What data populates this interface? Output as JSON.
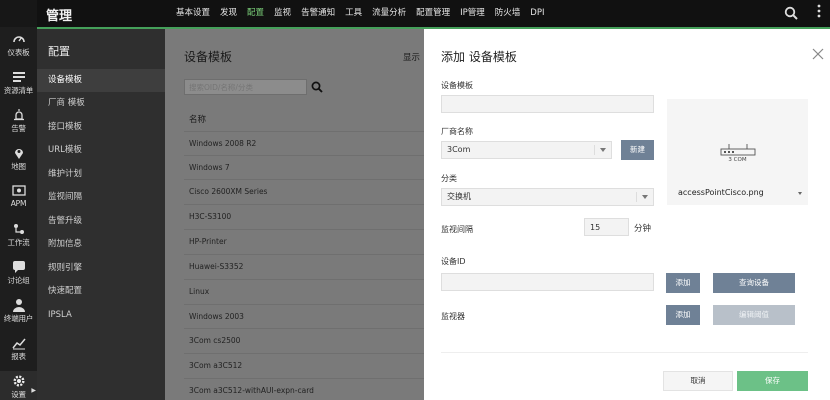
{
  "topbar": {
    "app_title": "管理",
    "nav": [
      {
        "label": "基本设置",
        "active": false
      },
      {
        "label": "发现",
        "active": false
      },
      {
        "label": "配置",
        "active": true
      },
      {
        "label": "监视",
        "active": false
      },
      {
        "label": "告警通知",
        "active": false
      },
      {
        "label": "工具",
        "active": false
      },
      {
        "label": "流量分析",
        "active": false
      },
      {
        "label": "配置管理",
        "active": false
      },
      {
        "label": "IP管理",
        "active": false
      },
      {
        "label": "防火墙",
        "active": false
      },
      {
        "label": "DPI",
        "active": false
      }
    ]
  },
  "rail": {
    "items": [
      {
        "label": "仪表板",
        "icon": "dashboard-icon"
      },
      {
        "label": "资源清单",
        "icon": "inventory-icon"
      },
      {
        "label": "告警",
        "icon": "alarm-icon"
      },
      {
        "label": "地图",
        "icon": "map-pin-icon"
      },
      {
        "label": "APM",
        "icon": "apm-icon"
      },
      {
        "label": "工作流",
        "icon": "workflow-icon"
      },
      {
        "label": "讨论组",
        "icon": "chat-icon"
      },
      {
        "label": "终端用户",
        "icon": "user-icon"
      },
      {
        "label": "报表",
        "icon": "report-icon"
      },
      {
        "label": "设置",
        "icon": "gear-icon"
      }
    ]
  },
  "sidebar": {
    "title": "配置",
    "items": [
      "设备模板",
      "厂商 模板",
      "接口模板",
      "URL模板",
      "维护计划",
      "监视间隔",
      "告警升级",
      "附加信息",
      "规则引擎",
      "快速配置",
      "IPSLA"
    ],
    "active_index": 0
  },
  "main": {
    "title": "设备模板",
    "show_label": "显示",
    "search_placeholder": "搜索OID/名称/分类",
    "column_name": "名称",
    "rows": [
      "Windows 2008 R2",
      "Windows 7",
      "Cisco 2600XM Series",
      "H3C-S3100",
      "HP-Printer",
      "Huawei-S3352",
      "Linux",
      "Windows 2003",
      "3Com cs2500",
      "3Com a3C512",
      "3Com a3C512-withAUI-expn-card"
    ]
  },
  "panel": {
    "title": "添加 设备模板",
    "template_label": "设备模板",
    "template_value": "",
    "vendor_label": "厂商名称",
    "vendor_value": "3Com",
    "new_button": "新建",
    "category_label": "分类",
    "category_value": "交换机",
    "interval_label": "监视间隔",
    "interval_value": "15",
    "interval_unit": "分钟",
    "device_id_label": "设备ID",
    "device_id_value": "",
    "add_button": "添加",
    "query_device_button": "查询设备",
    "monitor_label": "监视器",
    "monitor_add_button": "添加",
    "edit_threshold_button": "编辑阈值",
    "image_caption": "3 COM",
    "image_name": "accessPointCisco.png",
    "cancel_button": "取消",
    "save_button": "保存"
  },
  "colors": {
    "accent_green": "#45a05a",
    "save_green": "#6cc187",
    "button_blue": "#6f8196"
  }
}
